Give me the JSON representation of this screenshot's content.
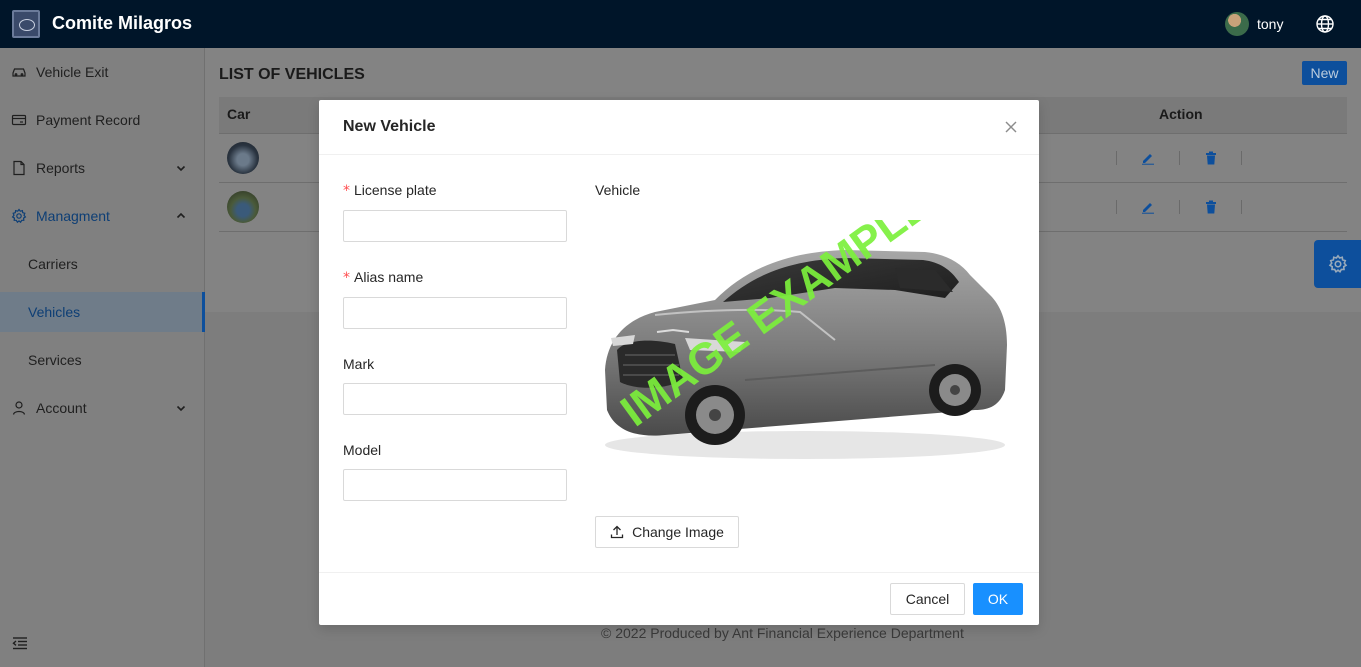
{
  "header": {
    "app_title": "Comite Milagros",
    "username": "tony"
  },
  "sidebar": {
    "items": [
      {
        "label": "Vehicle Exit",
        "icon": "car-icon"
      },
      {
        "label": "Payment Record",
        "icon": "wallet-icon"
      },
      {
        "label": "Reports",
        "icon": "file-icon"
      },
      {
        "label": "Managment",
        "icon": "gear-icon"
      },
      {
        "label": "Carriers"
      },
      {
        "label": "Vehicles"
      },
      {
        "label": "Services"
      },
      {
        "label": "Account",
        "icon": "user-icon"
      }
    ]
  },
  "main": {
    "title": "LIST OF VEHICLES",
    "new_label": "New",
    "columns": {
      "car": "Car",
      "action": "Action"
    },
    "rows": 2,
    "footer": "© 2022 Produced by Ant Financial Experience Department"
  },
  "modal": {
    "title": "New Vehicle",
    "fields": {
      "license_plate": {
        "label": "License plate",
        "required": true,
        "value": ""
      },
      "alias_name": {
        "label": "Alias name",
        "required": true,
        "value": ""
      },
      "mark": {
        "label": "Mark",
        "required": false,
        "value": ""
      },
      "model": {
        "label": "Model",
        "required": false,
        "value": ""
      }
    },
    "vehicle_label": "Vehicle",
    "watermark": "IMAGE EXAMPLE",
    "change_image_label": "Change Image",
    "cancel_label": "Cancel",
    "ok_label": "OK"
  },
  "colors": {
    "header_bg": "#001529",
    "primary": "#1890ff",
    "required": "#ff4d4f",
    "watermark": "#7cf03c"
  }
}
